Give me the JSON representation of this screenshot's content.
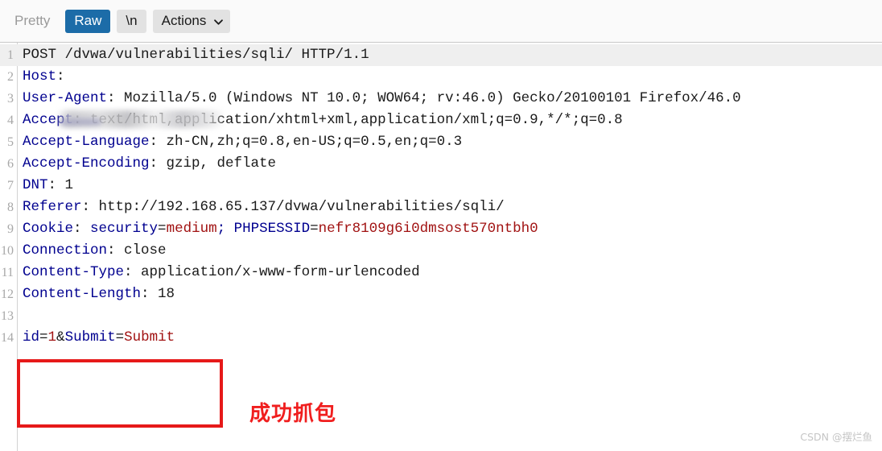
{
  "toolbar": {
    "pretty_label": "Pretty",
    "raw_label": "Raw",
    "newline_label": "\\n",
    "actions_label": "Actions",
    "active_tab": "Raw",
    "accent_color": "#1c6ca8",
    "caret_icon": "chevron-down-icon"
  },
  "editor": {
    "highlighted_line": 1,
    "colors": {
      "header_name": "#00008f",
      "value": "#1a1a1a",
      "red_value": "#a11212",
      "line_number": "#a8a8a8",
      "highlight_background": "#efefef",
      "annotation_red": "#f01e1e",
      "box_red": "#e61919"
    },
    "lines": [
      {
        "num": "1",
        "segments": [
          {
            "text": "POST /dvwa/vulnerabilities/sqli/ HTTP/1.1",
            "color": "v"
          }
        ]
      },
      {
        "num": "2",
        "segments": [
          {
            "text": "Host",
            "color": "k"
          },
          {
            "text": ":",
            "color": "v"
          }
        ],
        "redacted": true
      },
      {
        "num": "3",
        "segments": [
          {
            "text": "User-Agent",
            "color": "k"
          },
          {
            "text": ": Mozilla/5.0 (Windows NT 10.0; WOW64; rv:46.0) Gecko/20100101 Firefox/46.0",
            "color": "v"
          }
        ]
      },
      {
        "num": "4",
        "segments": [
          {
            "text": "Accept",
            "color": "k"
          },
          {
            "text": ": text/html,application/xhtml+xml,application/xml;q=0.9,*/*;q=0.8",
            "color": "v"
          }
        ]
      },
      {
        "num": "5",
        "segments": [
          {
            "text": "Accept-Language",
            "color": "k"
          },
          {
            "text": ": zh-CN,zh;q=0.8,en-US;q=0.5,en;q=0.3",
            "color": "v"
          }
        ]
      },
      {
        "num": "6",
        "segments": [
          {
            "text": "Accept-Encoding",
            "color": "k"
          },
          {
            "text": ": gzip, deflate",
            "color": "v"
          }
        ]
      },
      {
        "num": "7",
        "segments": [
          {
            "text": "DNT",
            "color": "k"
          },
          {
            "text": ": 1",
            "color": "v"
          }
        ]
      },
      {
        "num": "8",
        "segments": [
          {
            "text": "Referer",
            "color": "k"
          },
          {
            "text": ": http://192.168.65.137/dvwa/vulnerabilities/sqli/",
            "color": "v"
          }
        ]
      },
      {
        "num": "9",
        "segments": [
          {
            "text": "Cookie",
            "color": "k"
          },
          {
            "text": ": ",
            "color": "v"
          },
          {
            "text": "security",
            "color": "b"
          },
          {
            "text": "=",
            "color": "v"
          },
          {
            "text": "medium",
            "color": "r"
          },
          {
            "text": "; ",
            "color": "b"
          },
          {
            "text": "PHPSESSID",
            "color": "b"
          },
          {
            "text": "=",
            "color": "v"
          },
          {
            "text": "nefr8109g6i0dmsost570ntbh0",
            "color": "r"
          }
        ]
      },
      {
        "num": "10",
        "segments": [
          {
            "text": "Connection",
            "color": "k"
          },
          {
            "text": ": close",
            "color": "v"
          }
        ]
      },
      {
        "num": "11",
        "segments": [
          {
            "text": "Content-Type",
            "color": "k"
          },
          {
            "text": ": application/x-www-form-urlencoded",
            "color": "v"
          }
        ]
      },
      {
        "num": "12",
        "segments": [
          {
            "text": "Content-Length",
            "color": "k"
          },
          {
            "text": ": 18",
            "color": "v"
          }
        ]
      },
      {
        "num": "13",
        "segments": [
          {
            "text": "",
            "color": "v"
          }
        ]
      },
      {
        "num": "14",
        "segments": [
          {
            "text": "id",
            "color": "b"
          },
          {
            "text": "=",
            "color": "v"
          },
          {
            "text": "1",
            "color": "r"
          },
          {
            "text": "&",
            "color": "v"
          },
          {
            "text": "Submit",
            "color": "b"
          },
          {
            "text": "=",
            "color": "v"
          },
          {
            "text": "Submit",
            "color": "r"
          }
        ]
      }
    ]
  },
  "annotation": {
    "text": "成功抓包"
  },
  "watermark": {
    "text": "CSDN @摆烂鱼"
  }
}
